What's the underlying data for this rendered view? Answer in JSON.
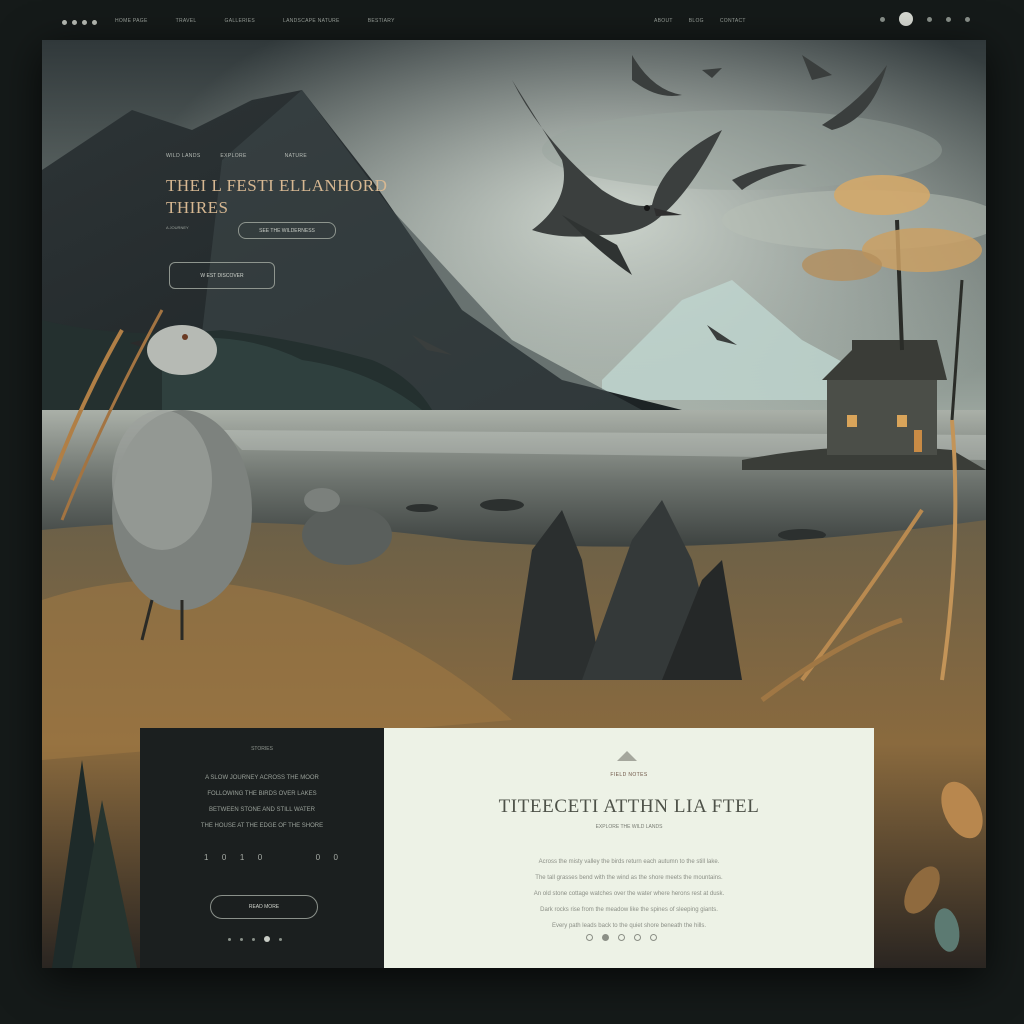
{
  "topbar": {
    "nav": [
      "HOME PAGE",
      "TRAVEL",
      "GALLERIES",
      "LANDSCAPE NATURE",
      "BESTIARY"
    ],
    "right_links": [
      "ABOUT",
      "BLOG",
      "CONTACT"
    ]
  },
  "hero": {
    "eyebrow_left": "WILD LANDS",
    "eyebrow_center": "EXPLORE",
    "eyebrow_right": "NATURE",
    "title_line1": "THEI L FESTI ELLANHORD",
    "title_line2": "THIRES",
    "subtitle": "A JOURNEY",
    "pill_label": "SEE THE WILDERNESS",
    "cta_label": "W EST DISCOVER"
  },
  "card_dark": {
    "label": "STORIES",
    "lines": [
      "A SLOW JOURNEY ACROSS THE MOOR",
      "FOLLOWING THE BIRDS OVER LAKES",
      "BETWEEN STONE AND STILL WATER",
      "THE HOUSE AT THE EDGE OF THE SHORE"
    ],
    "stats": [
      "1",
      "0",
      "1",
      "0",
      "0",
      "0"
    ],
    "button_label": "READ MORE"
  },
  "card_light": {
    "eyebrow": "FIELD NOTES",
    "title": "TITEECETI ATTHN LIA FTEL",
    "subtitle": "EXPLORE THE WILD LANDS",
    "body": [
      "Across the misty valley the birds return each autumn to the still lake.",
      "The tall grasses bend with the wind as the shore meets the mountains.",
      "An old stone cottage watches over the water where herons rest at dusk.",
      "Dark rocks rise from the meadow like the spines of sleeping giants.",
      "Every path leads back to the quiet shore beneath the hills."
    ]
  },
  "colors": {
    "background": "#151a19",
    "accent_gold": "#d7b892",
    "card_dark": "#1b1f1f",
    "card_light": "#edf2e6"
  }
}
